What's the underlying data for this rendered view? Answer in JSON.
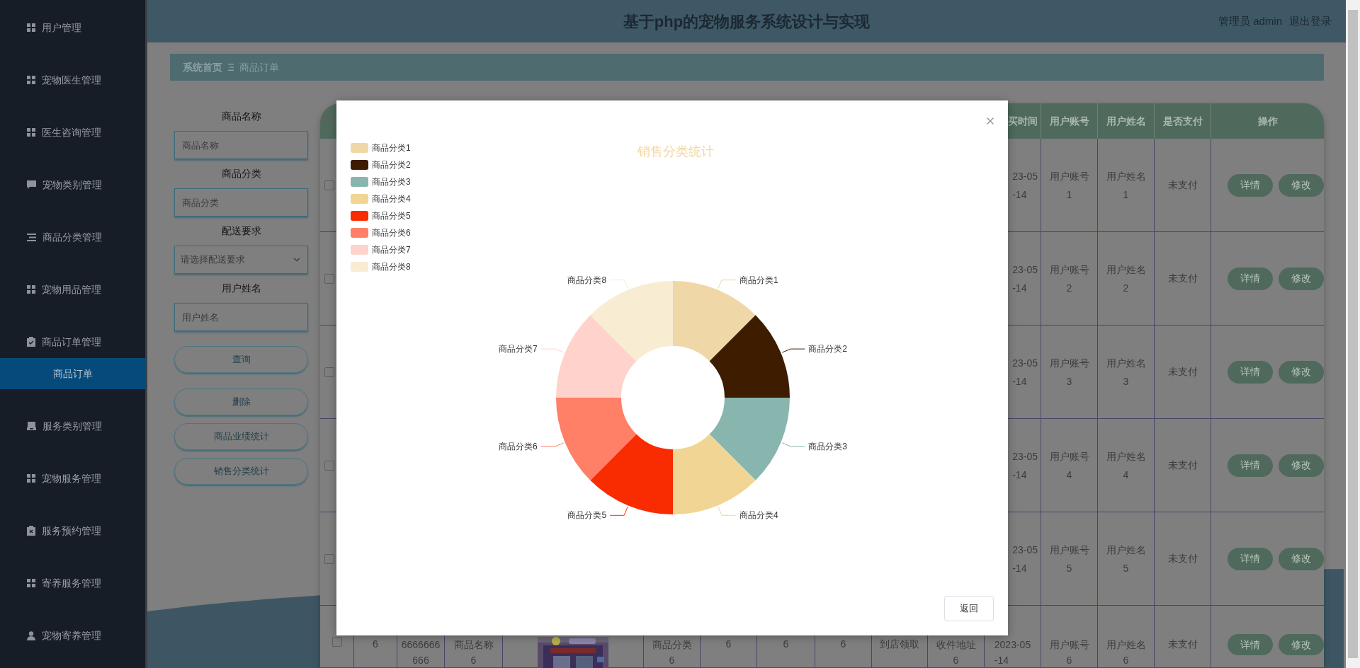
{
  "header": {
    "title": "基于php的宠物服务系统设计与实现",
    "user": "管理员 admin",
    "logout": "退出登录"
  },
  "sidebar": {
    "items": [
      {
        "label": "用户管理",
        "selected": false
      },
      {
        "label": "宠物医生管理",
        "selected": false
      },
      {
        "label": "医生咨询管理",
        "selected": false
      },
      {
        "label": "宠物类别管理",
        "selected": false
      },
      {
        "label": "商品分类管理",
        "selected": false
      },
      {
        "label": "宠物用品管理",
        "selected": false
      },
      {
        "label": "商品订单管理",
        "selected": false,
        "expanded": true,
        "children": [
          {
            "label": "商品订单",
            "selected": true
          }
        ]
      },
      {
        "label": "服务类别管理",
        "selected": false
      },
      {
        "label": "宠物服务管理",
        "selected": false
      },
      {
        "label": "服务预约管理",
        "selected": false
      },
      {
        "label": "寄养服务管理",
        "selected": false
      },
      {
        "label": "宠物寄养管理",
        "selected": false
      }
    ]
  },
  "breadcrumb": [
    "系统首页",
    "商品订单"
  ],
  "filters": [
    {
      "label": "商品名称",
      "kind": "input",
      "placeholder": "商品名称"
    },
    {
      "label": "商品分类",
      "kind": "input",
      "placeholder": "商品分类"
    },
    {
      "label": "配送要求",
      "kind": "select",
      "placeholder": "请选择配送要求"
    },
    {
      "label": "用户姓名",
      "kind": "input",
      "placeholder": "用户姓名"
    }
  ],
  "actions": [
    "查询",
    "删除",
    "商品业绩统计",
    "销售分类统计"
  ],
  "table": {
    "header": {
      "checked": false,
      "columns": [
        "买时间",
        "用户账号",
        "用户姓名",
        "是否支付",
        "操作"
      ]
    },
    "rows": [
      {
        "checked": false,
        "time_lines": [
          "23-05",
          "-14"
        ],
        "account": "用户账号1",
        "name": "用户姓名1",
        "paid": "未支付",
        "buttons": [
          "详情",
          "修改"
        ]
      },
      {
        "checked": false,
        "time_lines": [
          "23-05",
          "-14"
        ],
        "account": "用户账号2",
        "name": "用户姓名2",
        "paid": "未支付",
        "buttons": [
          "详情",
          "修改"
        ]
      },
      {
        "checked": false,
        "time_lines": [
          "23-05",
          "-14"
        ],
        "account": "用户账号3",
        "name": "用户姓名3",
        "paid": "未支付",
        "buttons": [
          "详情",
          "修改"
        ]
      },
      {
        "checked": false,
        "time_lines": [
          "23-05",
          "-14"
        ],
        "account": "用户账号4",
        "name": "用户姓名4",
        "paid": "未支付",
        "buttons": [
          "详情",
          "修改"
        ]
      },
      {
        "checked": false,
        "time_lines": [
          "23-05",
          "-14"
        ],
        "account": "用户账号5",
        "name": "用户姓名5",
        "paid": "未支付",
        "buttons": [
          "详情",
          "修改"
        ]
      },
      {
        "checked": false,
        "index": "6",
        "number": "6666666666",
        "product": "商品名称6",
        "category": "商品分类6",
        "column_7": "6",
        "column_8": "6",
        "column_9": "6",
        "delivery": "到店领取",
        "address": "收件地址6",
        "time_lines": [
          "2023-05",
          "-14"
        ],
        "account": "用户账号6",
        "name": "用户姓名6",
        "paid": "未支付",
        "buttons": [
          "详情",
          "修改"
        ]
      }
    ]
  },
  "dialog": {
    "legend": [
      {
        "label": "商品分类1",
        "color": "#f0d7a8"
      },
      {
        "label": "商品分类2",
        "color": "#3d1c00"
      },
      {
        "label": "商品分类3",
        "color": "#88b6ae"
      },
      {
        "label": "商品分类4",
        "color": "#f1d594"
      },
      {
        "label": "商品分类5",
        "color": "#f92b00"
      },
      {
        "label": "商品分类6",
        "color": "#ff7f67"
      },
      {
        "label": "商品分类7",
        "color": "#ffd3cb"
      },
      {
        "label": "商品分类8",
        "color": "#f8ecd3"
      }
    ],
    "chart_data": {
      "type": "donut",
      "title": "销售分类统计",
      "categories": [
        "商品分类1",
        "商品分类2",
        "商品分类3",
        "商品分类4",
        "商品分类5",
        "商品分类6",
        "商品分类7",
        "商品分类8"
      ],
      "values": [
        1,
        1,
        1,
        1,
        1,
        1,
        1,
        1
      ]
    },
    "button": "返回"
  }
}
